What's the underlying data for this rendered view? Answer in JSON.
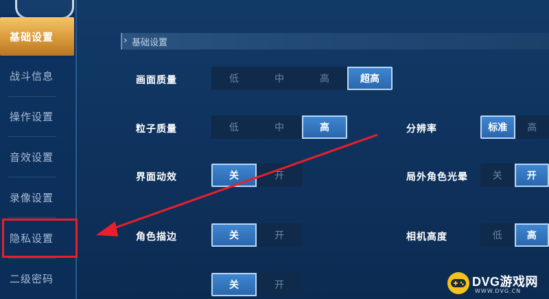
{
  "sidebar": {
    "items": [
      {
        "label": "基础设置",
        "active": true
      },
      {
        "label": "战斗信息",
        "active": false
      },
      {
        "label": "操作设置",
        "active": false
      },
      {
        "label": "音效设置",
        "active": false
      },
      {
        "label": "录像设置",
        "active": false
      },
      {
        "label": "隐私设置",
        "active": false
      },
      {
        "label": "二级密码",
        "active": false
      }
    ]
  },
  "section": {
    "title": "基础设置"
  },
  "settings": {
    "graphics_quality": {
      "label": "画面质量",
      "options": [
        "低",
        "中",
        "高",
        "超高"
      ],
      "selected": "超高"
    },
    "particle_quality": {
      "label": "粒子质量",
      "options": [
        "低",
        "中",
        "高"
      ],
      "selected": "高"
    },
    "resolution": {
      "label": "分辨率",
      "options": [
        "标准",
        "高"
      ],
      "selected": "标准"
    },
    "ui_animation": {
      "label": "界面动效",
      "options": [
        "关",
        "开"
      ],
      "selected": "关"
    },
    "outside_halo": {
      "label": "局外角色光晕",
      "options": [
        "关",
        "开"
      ],
      "selected": "开"
    },
    "char_outline": {
      "label": "角色描边",
      "options": [
        "关",
        "开"
      ],
      "selected": "关"
    },
    "camera_height": {
      "label": "相机高度",
      "options": [
        "低",
        "高"
      ],
      "selected": "高"
    },
    "row_partial_left": {
      "options": [
        "关",
        "开"
      ],
      "selected": "关"
    }
  },
  "watermark": {
    "brand": "DVG游戏网",
    "url": "WWW.DVG.CN"
  },
  "colors": {
    "accent_gold": "#d99a39",
    "selected_blue": "#2a68ad",
    "annotation_red": "#e8202a"
  }
}
